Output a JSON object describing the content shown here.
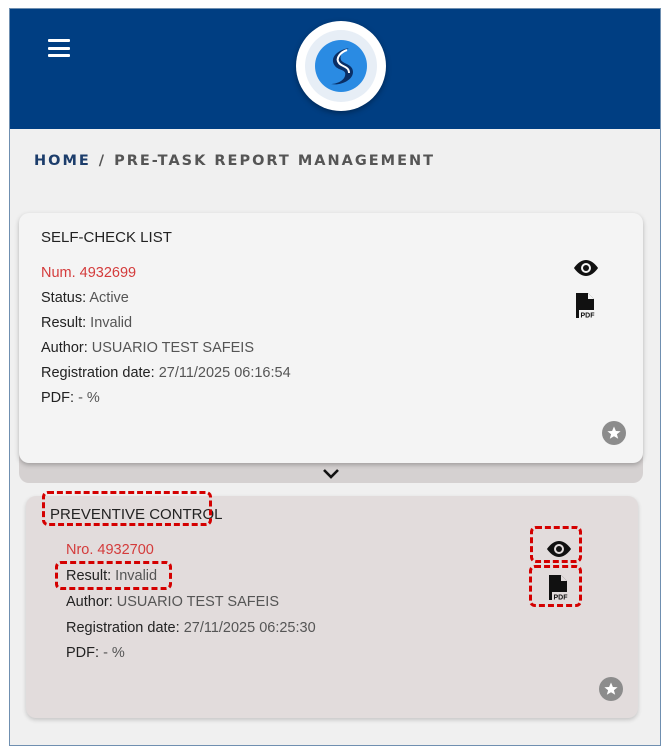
{
  "header": {
    "menu_icon": "hamburger-menu-icon",
    "logo_icon": "company-logo",
    "brand_color": "#003e82"
  },
  "breadcrumb": {
    "home": "HOME",
    "separator": "/",
    "current": "PRE-TASK REPORT MANAGEMENT"
  },
  "cards": [
    {
      "title": "SELF-CHECK LIST",
      "number": "Num. 4932699",
      "status_label": "Status:",
      "status_value": "Active",
      "result_label": "Result:",
      "result_value": "Invalid",
      "author_label": "Author:",
      "author_value": "USUARIO TEST SAFEIS",
      "date_label": "Registration date:",
      "date_value": "27/11/2025 06:16:54",
      "pdf_label": "PDF:",
      "pdf_value": "- %"
    },
    {
      "title": "PREVENTIVE CONTROL",
      "number": "Nro. 4932700",
      "result_label": "Result:",
      "result_value": "Invalid",
      "author_label": "Author:",
      "author_value": "USUARIO TEST SAFEIS",
      "date_label": "Registration date:",
      "date_value": "27/11/2025 06:25:30",
      "pdf_label": "PDF:",
      "pdf_value": "- %"
    }
  ],
  "icons": {
    "view": "eye-icon",
    "pdf": "pdf-file-icon",
    "pdf_text": "PDF",
    "favorite": "star-icon",
    "expand": "chevron-down-icon"
  },
  "colors": {
    "number_red": "#d43b3b",
    "highlight": "#d40000"
  }
}
